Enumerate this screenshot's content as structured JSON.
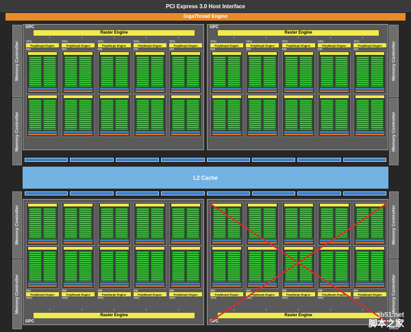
{
  "header": {
    "host_interface": "PCI Express 3.0 Host Interface",
    "gigathread": "GigaThread Engine"
  },
  "labels": {
    "gpc": "GPC",
    "raster_engine": "Raster Engine",
    "polymorph_engine": "PolyMorph Engine",
    "tpc": "TPC",
    "sm": "SM",
    "memory_controller": "Memory Controller",
    "l2_cache": "L2 Cache"
  },
  "watermark": {
    "site": "jb51.net",
    "name": "脚本之家"
  },
  "colors": {
    "background": "#262626",
    "gigathread": "#e98a2a",
    "engine_yellow": "#f0ea4a",
    "core_green": "#39c23a",
    "l2_blue": "#73b3e3",
    "disabled_cross": "#e02a2a"
  }
}
